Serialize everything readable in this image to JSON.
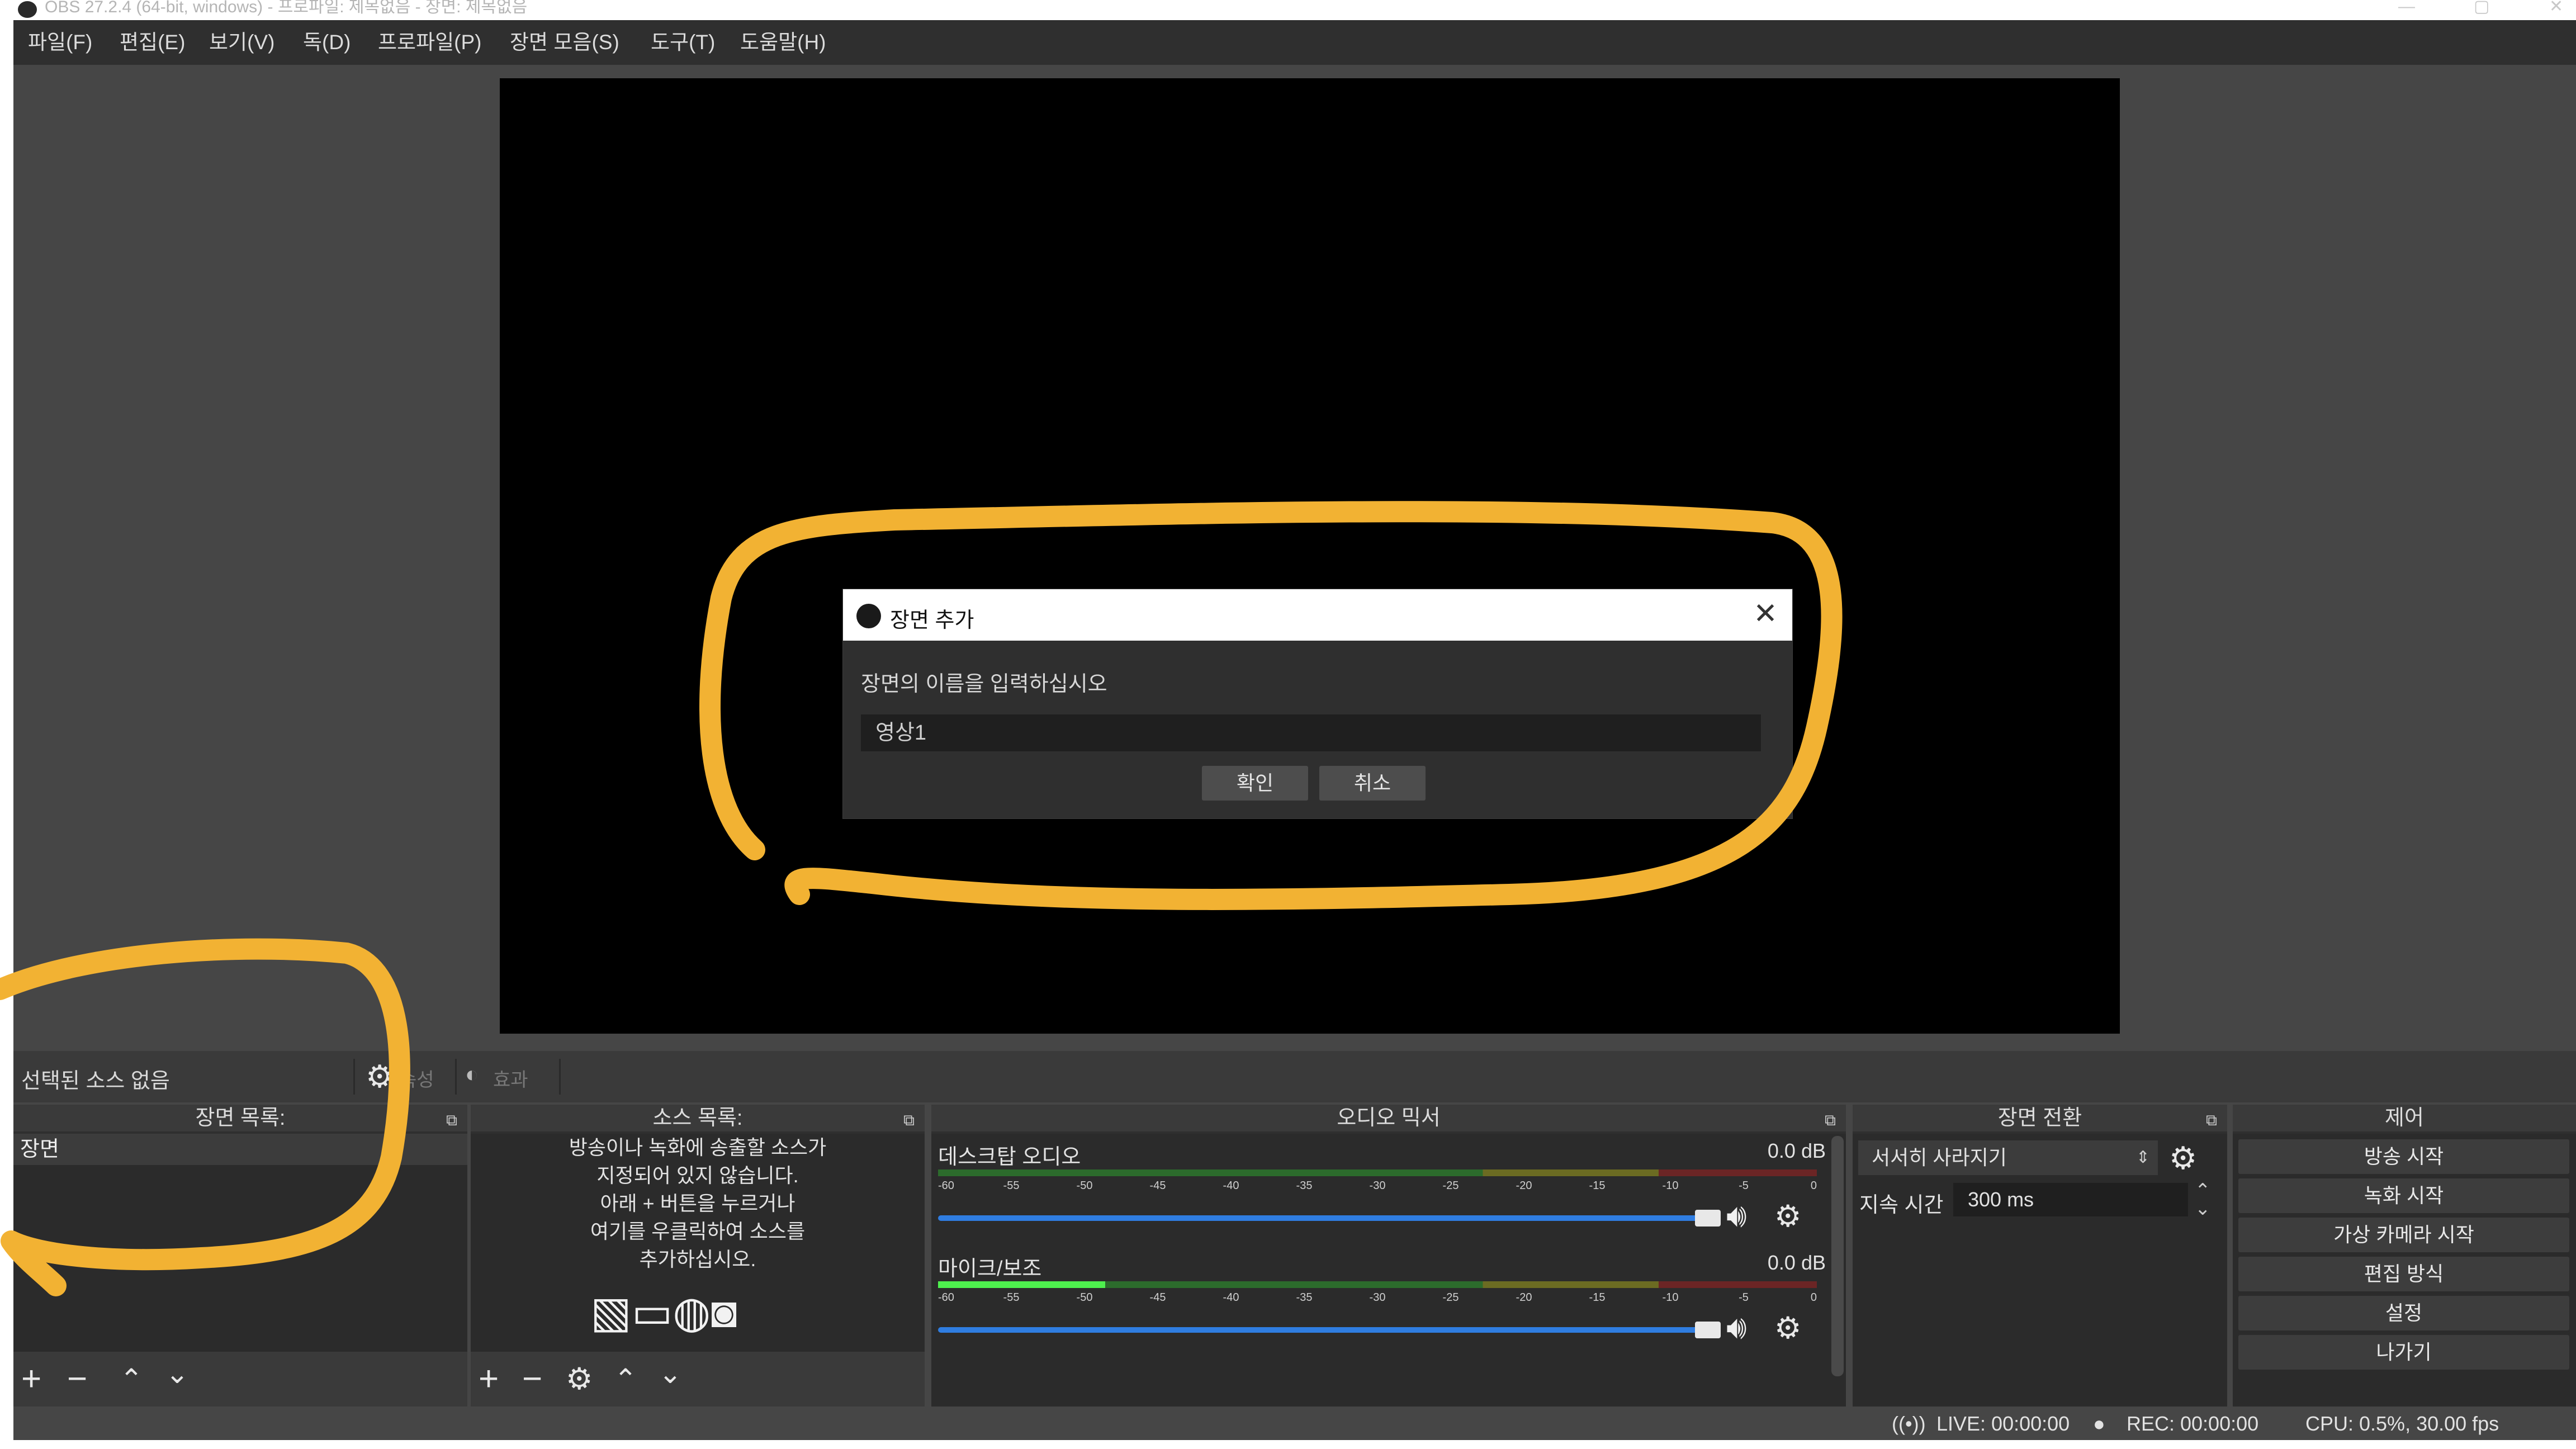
{
  "window": {
    "title": "OBS 27.2.4 (64-bit, windows) - 프로파일: 제목없음 - 장면: 제목없음"
  },
  "menu": [
    "파일(F)",
    "편집(E)",
    "보기(V)",
    "독(D)",
    "프로파일(P)",
    "장면 모음(S)",
    "도구(T)",
    "도움말(H)"
  ],
  "dialog": {
    "title": "장면 추가",
    "prompt": "장면의 이름을 입력하십시오",
    "input_value": "영상1",
    "ok_label": "확인",
    "cancel_label": "취소"
  },
  "source_toolbar": {
    "no_source_label": "선택된 소스 없음",
    "properties_label": "속성",
    "filters_label": "효과"
  },
  "scenes": {
    "header": "장면 목록:",
    "items": [
      "장면"
    ]
  },
  "sources": {
    "header": "소스 목록:",
    "empty_lines": [
      "방송이나 녹화에 송출할 소스가",
      "지정되어 있지 않습니다.",
      "아래 + 버튼을 누르거나",
      "여기를 우클릭하여 소스를",
      "추가하십시오."
    ]
  },
  "mixer": {
    "header": "오디오 믹서",
    "ticks": [
      "-60",
      "-55",
      "-50",
      "-45",
      "-40",
      "-35",
      "-30",
      "-25",
      "-20",
      "-15",
      "-10",
      "-5",
      "0"
    ],
    "channels": [
      {
        "name": "데스크탑 오디오",
        "db": "0.0 dB",
        "level": 0.0,
        "volume": 1.0
      },
      {
        "name": "마이크/보조",
        "db": "0.0 dB",
        "level": 0.19,
        "volume": 1.0
      }
    ]
  },
  "transitions": {
    "header": "장면 전환",
    "selected": "서서히 사라지기",
    "duration_label": "지속 시간",
    "duration_value": "300 ms"
  },
  "controls": {
    "header": "제어",
    "buttons": [
      "방송 시작",
      "녹화 시작",
      "가상 카메라 시작",
      "편집 방식",
      "설정",
      "나가기"
    ]
  },
  "status": {
    "live": "LIVE: 00:00:00",
    "rec": "REC: 00:00:00",
    "cpu": "CPU: 0.5%, 30.00 fps"
  },
  "colors": {
    "annotation": "#f2b233",
    "app_bg": "#464646",
    "dock_bg": "#2f2f2f",
    "volume": "#2f7de1"
  },
  "icons": [
    "obs-logo-icon",
    "close-icon",
    "gear-icon",
    "filter-icon",
    "plus-icon",
    "minus-icon",
    "arrow-up-icon",
    "arrow-down-icon",
    "popout-icon",
    "speaker-icon",
    "image-icon",
    "display-icon",
    "globe-icon",
    "camera-icon",
    "live-icon",
    "record-icon"
  ]
}
